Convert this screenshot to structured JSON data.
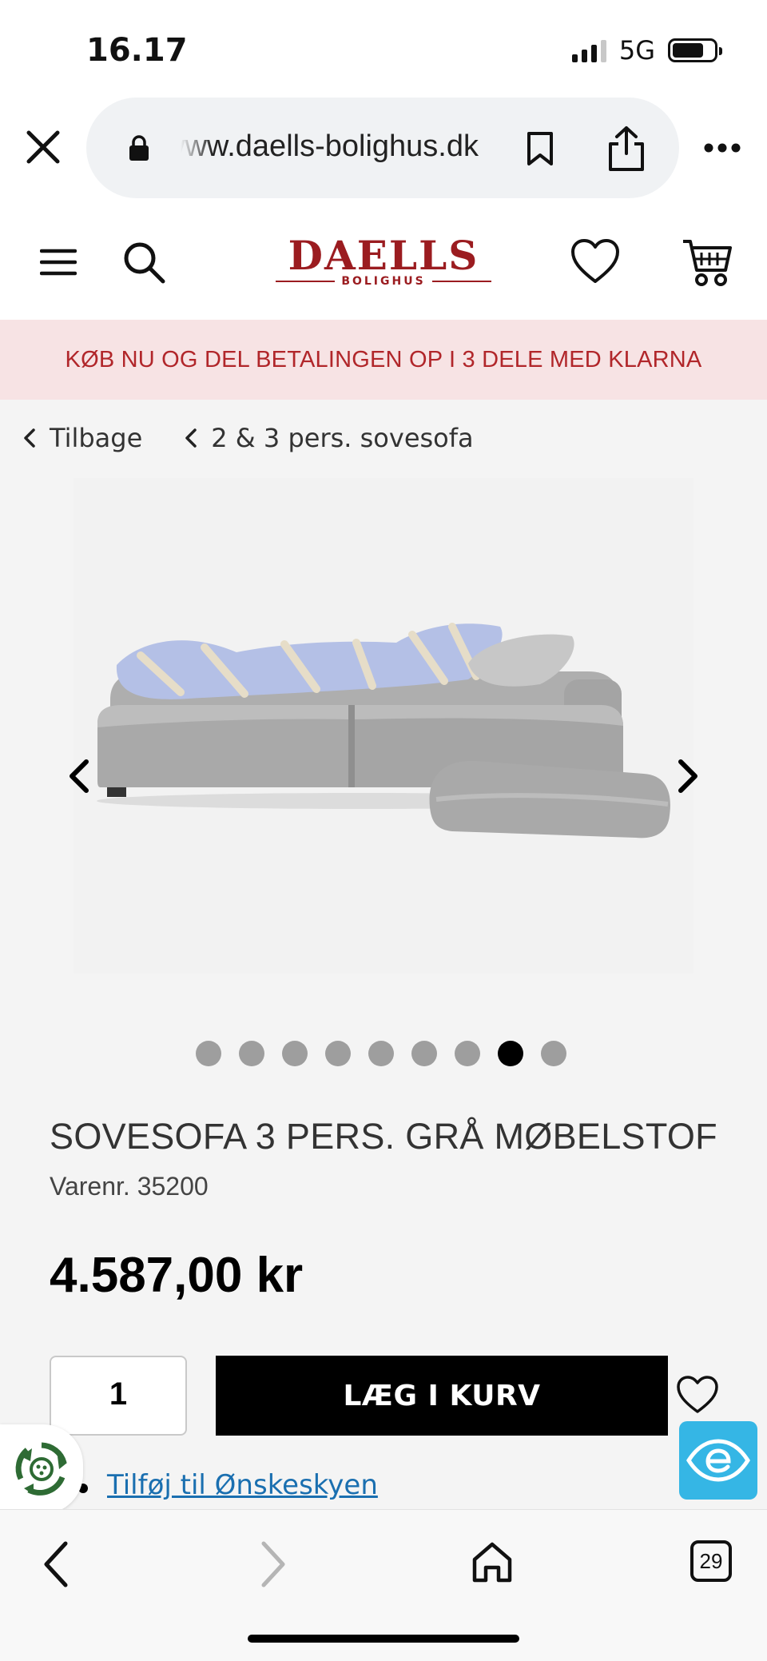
{
  "status_bar": {
    "time": "16.17",
    "network": "5G"
  },
  "browser": {
    "url": "www.daells-bolighus.dk",
    "tab_count": "29"
  },
  "site": {
    "logo_main": "DAELLS",
    "logo_sub": "BOLIGHUS"
  },
  "banner": {
    "text": "KØB NU OG DEL BETALINGEN OP I 3 DELE MED KLARNA"
  },
  "breadcrumb": {
    "back_label": "Tilbage",
    "category_label": "2 & 3 pers. sovesofa"
  },
  "gallery": {
    "image_count": 9,
    "active_index": 7
  },
  "product": {
    "title": "SOVESOFA 3 PERS. GRÅ MØBELSTOF",
    "sku": "Varenr. 35200",
    "price": "4.587,00 kr",
    "quantity": "1",
    "add_to_cart_label": "LÆG I KURV",
    "wishlist_link": "Tilføj til Ønskeskyen"
  },
  "colors": {
    "brand": "#9b1c20",
    "banner_bg": "#f7e3e4",
    "banner_text": "#b1262a",
    "link": "#1a6fb0",
    "eye_widget": "#35b6e5"
  },
  "icons": [
    "close-icon",
    "lock-icon",
    "bookmark-icon",
    "share-icon",
    "more-icon",
    "menu-icon",
    "search-icon",
    "heart-icon",
    "cart-icon",
    "chevron-left-icon",
    "chevron-right-icon",
    "recycle-icon",
    "eye-icon",
    "home-icon",
    "tabs-icon"
  ]
}
